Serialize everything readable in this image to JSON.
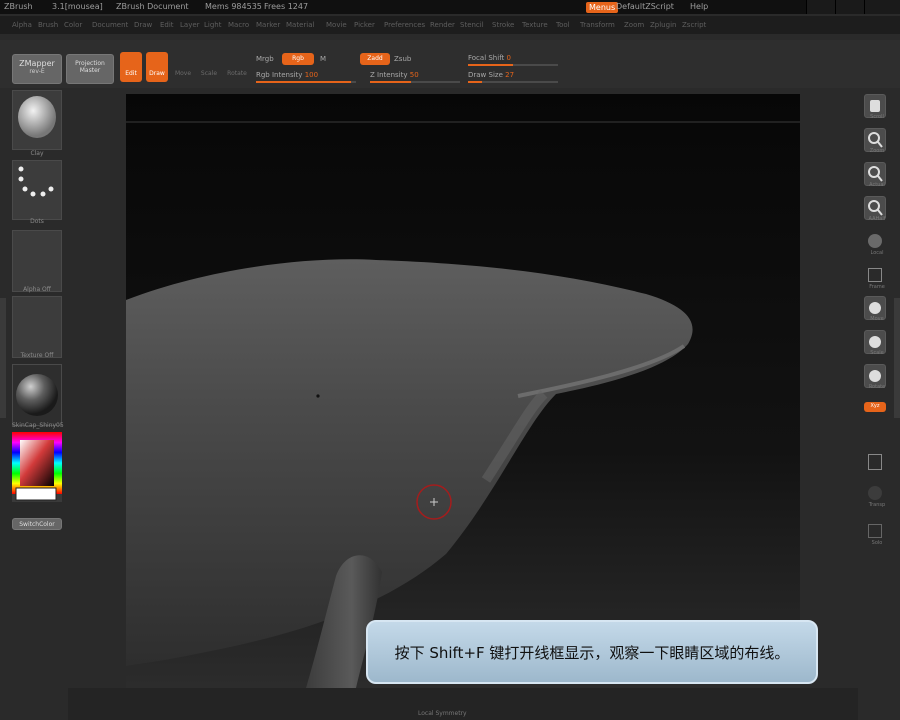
{
  "titlebar": {
    "app": "ZBrush",
    "version": "3.1[mousea]",
    "doc": "ZBrush Document",
    "mem": "Mems 984535",
    "free": "Frees 1247",
    "menus_btn": "Menus",
    "script": "DefaultZScript",
    "help": "Help"
  },
  "menubar": {
    "items": [
      "Alpha",
      "Brush",
      "Color",
      "Document",
      "Draw",
      "Edit",
      "Layer",
      "Light",
      "Macro",
      "Marker",
      "Material",
      "Movie",
      "Picker",
      "Preferences",
      "Render",
      "Stencil",
      "Stroke",
      "Texture",
      "Tool",
      "Transform",
      "Zoom",
      "Zplugin",
      "Zscript"
    ]
  },
  "toolbar": {
    "zmapper": "ZMapper",
    "zmapper_sub": "rev-E",
    "projection": "Projection",
    "projection_sub": "Master",
    "edit": "Edit",
    "draw": "Draw",
    "move": "Move",
    "scale": "Scale",
    "rotate": "Rotate",
    "mrgb": "Mrgb",
    "rgb": "Rgb",
    "m": "M",
    "rgb_intensity_label": "Rgb Intensity",
    "rgb_intensity_value": "100",
    "rgb_intensity_level": 0.95,
    "zadd": "Zadd",
    "zsub": "Zsub",
    "z_intensity_label": "Z Intensity",
    "z_intensity_value": "50",
    "z_intensity_level": 0.45,
    "focal_label": "Focal Shift",
    "focal_value": "0",
    "focal_level": 0.5,
    "draw_size_label": "Draw Size",
    "draw_size_value": "27",
    "draw_size_level": 0.15
  },
  "leftshelf": {
    "brush_label": "Clay",
    "stroke_label": "Dots",
    "alpha_label": "Alpha Off",
    "texture_label": "Texture Off",
    "material_label": "SkinCap_Shiny05",
    "switch_color": "SwitchColor"
  },
  "rightshelf": {
    "labels": [
      "Scroll",
      "Zoom",
      "Actual",
      "AAHalf",
      "Local",
      "Frame",
      "Move",
      "Scale",
      "Rotate",
      "Xyz",
      "",
      "Transp",
      "Ghost",
      "Solo"
    ]
  },
  "bottom": {
    "label": "Local Symmetry"
  },
  "subtitle": "按下 Shift+F 键打开线框显示，观察一下眼睛区域的布线。",
  "colors": {
    "accent": "#e6641a",
    "subtitle_bg": "#b3cbe0",
    "viewport_bg": "#0e0e0e"
  }
}
